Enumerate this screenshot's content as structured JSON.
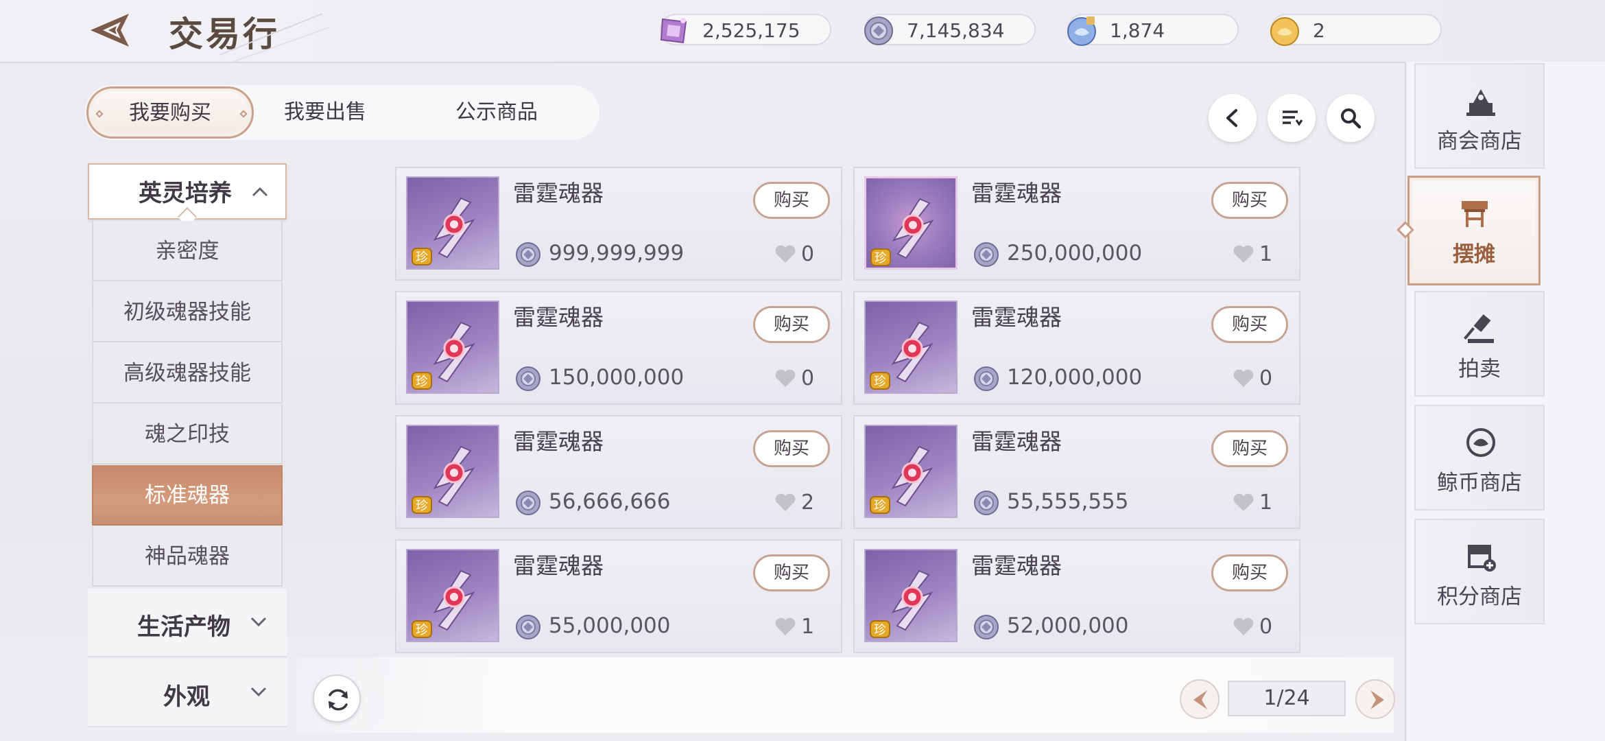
{
  "header": {
    "title": "交易行"
  },
  "currencies": [
    {
      "icon": "crystal-currency-icon",
      "value": "2,525,175"
    },
    {
      "icon": "silver-coin-icon",
      "value": "7,145,834"
    },
    {
      "icon": "whale-bound-coin-icon",
      "value": "1,874"
    },
    {
      "icon": "whale-gold-coin-icon",
      "value": "2"
    }
  ],
  "tabs": [
    {
      "label": "我要购买",
      "active": true
    },
    {
      "label": "我要出售",
      "active": false
    },
    {
      "label": "公示商品",
      "active": false
    }
  ],
  "sidebar": {
    "expanded_group": "英灵培养",
    "items": [
      {
        "label": "亲密度",
        "active": false
      },
      {
        "label": "初级魂器技能",
        "active": false
      },
      {
        "label": "高级魂器技能",
        "active": false
      },
      {
        "label": "魂之印技",
        "active": false
      },
      {
        "label": "标准魂器",
        "active": true
      },
      {
        "label": "神品魂器",
        "active": false
      }
    ],
    "collapsed_groups": [
      "生活产物",
      "外观"
    ]
  },
  "listings": [
    {
      "name": "雷霆魂器",
      "price": "999,999,999",
      "likes": "0",
      "buy_label": "购买",
      "badge": "珍",
      "special": false
    },
    {
      "name": "雷霆魂器",
      "price": "250,000,000",
      "likes": "1",
      "buy_label": "购买",
      "badge": "珍",
      "special": true
    },
    {
      "name": "雷霆魂器",
      "price": "150,000,000",
      "likes": "0",
      "buy_label": "购买",
      "badge": "珍",
      "special": false
    },
    {
      "name": "雷霆魂器",
      "price": "120,000,000",
      "likes": "0",
      "buy_label": "购买",
      "badge": "珍",
      "special": false
    },
    {
      "name": "雷霆魂器",
      "price": "56,666,666",
      "likes": "2",
      "buy_label": "购买",
      "badge": "珍",
      "special": false
    },
    {
      "name": "雷霆魂器",
      "price": "55,555,555",
      "likes": "1",
      "buy_label": "购买",
      "badge": "珍",
      "special": false
    },
    {
      "name": "雷霆魂器",
      "price": "55,000,000",
      "likes": "1",
      "buy_label": "购买",
      "badge": "珍",
      "special": false
    },
    {
      "name": "雷霆魂器",
      "price": "52,000,000",
      "likes": "0",
      "buy_label": "购买",
      "badge": "珍",
      "special": false
    }
  ],
  "pagination": {
    "page": "1/24"
  },
  "right_nav": [
    {
      "label": "商会商店",
      "icon": "guild-shop-icon",
      "active": false
    },
    {
      "label": "摆摊",
      "icon": "stall-icon",
      "active": true
    },
    {
      "label": "拍卖",
      "icon": "auction-hammer-icon",
      "active": false
    },
    {
      "label": "鲸币商店",
      "icon": "whale-coin-shop-icon",
      "active": false
    },
    {
      "label": "积分商店",
      "icon": "points-shop-icon",
      "active": false
    }
  ],
  "colors": {
    "accent": "#c58a6a",
    "active_text": "#9b5f3e",
    "item_bg": "#8e74b8"
  }
}
